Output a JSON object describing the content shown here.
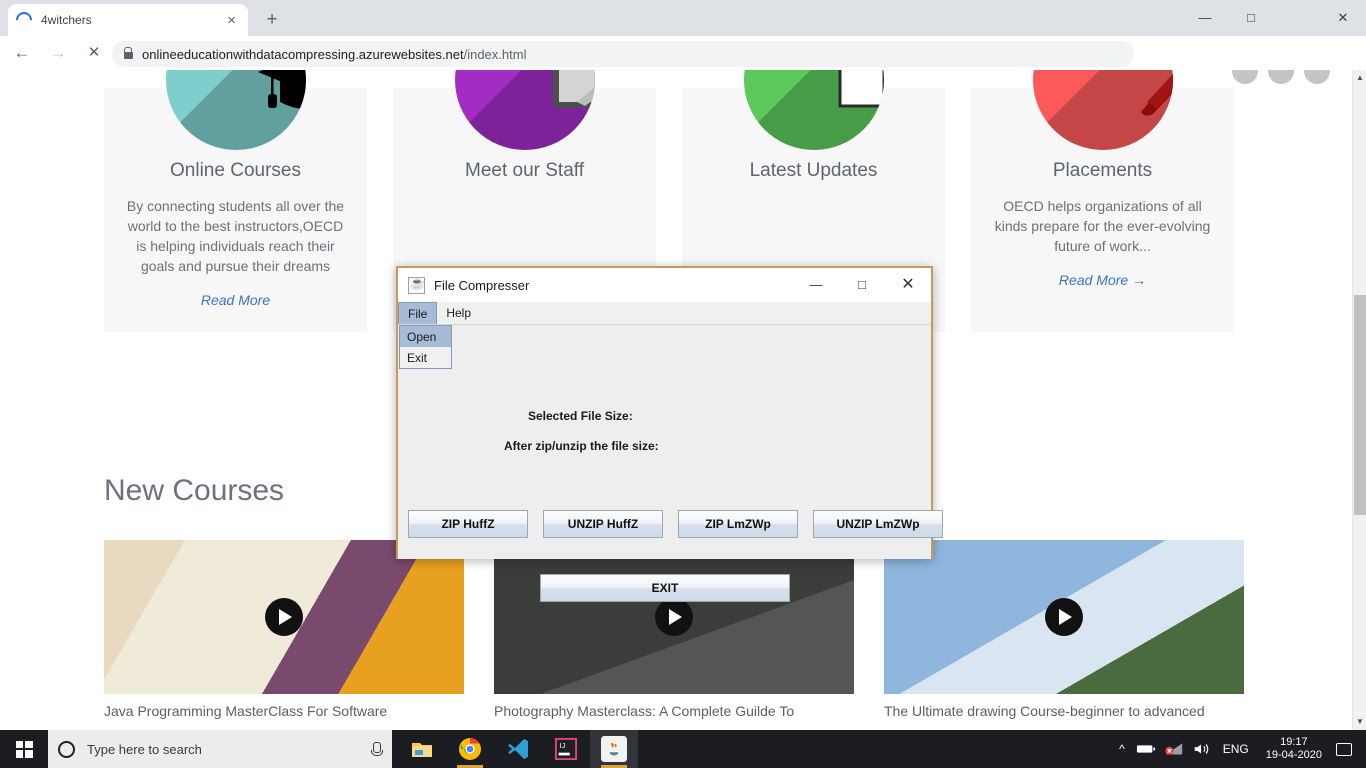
{
  "browser": {
    "tab": {
      "title": "4witchers",
      "spinner_icon": "loading-spinner-icon",
      "close_icon": "×"
    },
    "new_tab_icon": "+",
    "window_controls": {
      "minimize": "—",
      "maximize": "□",
      "close": "✕"
    },
    "nav": {
      "back_icon": "←",
      "forward_icon": "→",
      "stop_icon": "✕"
    },
    "url": {
      "secure_icon": "lock-icon",
      "domain": "onlineeducationwithdatacompressing.azurewebsites.net",
      "path": "/index.html"
    },
    "toolbar_icons": [
      "bookmark-star-icon",
      "adobe-acrobat-icon",
      "screenshot-camera-icon",
      "lightning-bolt-icon",
      "profile-avatar",
      "chrome-menu-icon"
    ]
  },
  "page": {
    "cards": [
      {
        "icon": "graduation-cap-icon",
        "icon_color": "#7ececd",
        "title": "Online Courses",
        "body": "By connecting students all over the world to the best instructors,OECD is helping individuals reach their goals and pursue their dreams",
        "link": "Read More"
      },
      {
        "icon": "whiteboard-pen-icon",
        "icon_color": "#a22cc4",
        "title": "Meet our Staff",
        "body": "",
        "link": ""
      },
      {
        "icon": "open-book-icon",
        "icon_color": "#5bc95c",
        "title": "Latest Updates",
        "body": "",
        "link": ""
      },
      {
        "icon": "pen-icon",
        "icon_color": "#fc5a5a",
        "title": "Placements",
        "body": "OECD helps organizations of all kinds prepare for the ever-evolving future of work...",
        "link": "Read More →"
      }
    ],
    "new_courses_heading": "New Courses",
    "courses": [
      {
        "caption": "Java Programming MasterClass For Software",
        "play_icon": "play-button-icon"
      },
      {
        "caption": "Photography Masterclass: A Complete Guilde To",
        "play_icon": "play-button-icon"
      },
      {
        "caption": "The Ultimate drawing Course-beginner to advanced",
        "play_icon": "play-button-icon"
      }
    ],
    "scrollbar": {
      "up_arrow": "▲",
      "down_arrow": "▼"
    }
  },
  "dialog": {
    "title": "File Compresser",
    "app_icon": "java-coffee-cup-icon",
    "window_controls": {
      "minimize": "—",
      "maximize": "□",
      "close": "✕"
    },
    "menus": [
      {
        "label": "File",
        "open": true
      },
      {
        "label": "Help",
        "open": false
      }
    ],
    "file_menu_items": [
      {
        "label": "Open",
        "selected": true
      },
      {
        "label": "Exit",
        "selected": false
      }
    ],
    "labels": {
      "selected_size": "Selected File Size:",
      "after_size": "After zip/unzip the file size:"
    },
    "buttons": [
      "ZIP HuffZ",
      "UNZIP HuffZ",
      "ZIP LmZWp",
      "UNZIP LmZWp"
    ],
    "exit_button": "EXIT",
    "border_color": "#c79a59"
  },
  "taskbar": {
    "start_icon": "windows-start-icon",
    "search": {
      "icon": "cortana-circle-icon",
      "placeholder": "Type here to search",
      "mic_icon": "microphone-icon"
    },
    "apps": [
      {
        "name": "file-explorer-icon",
        "active": false
      },
      {
        "name": "google-chrome-icon",
        "active": false,
        "running": true
      },
      {
        "name": "vs-code-icon",
        "active": false
      },
      {
        "name": "intellij-idea-icon",
        "active": false
      },
      {
        "name": "java-app-icon",
        "active": true
      }
    ],
    "tray": {
      "chevron": "^",
      "battery_icon": "battery-icon",
      "network_icon": "wifi-disconnected-icon",
      "volume_icon": "volume-icon",
      "language": "ENG",
      "time": "19:17",
      "date": "19-04-2020",
      "action_center_icon": "notification-icon"
    }
  }
}
